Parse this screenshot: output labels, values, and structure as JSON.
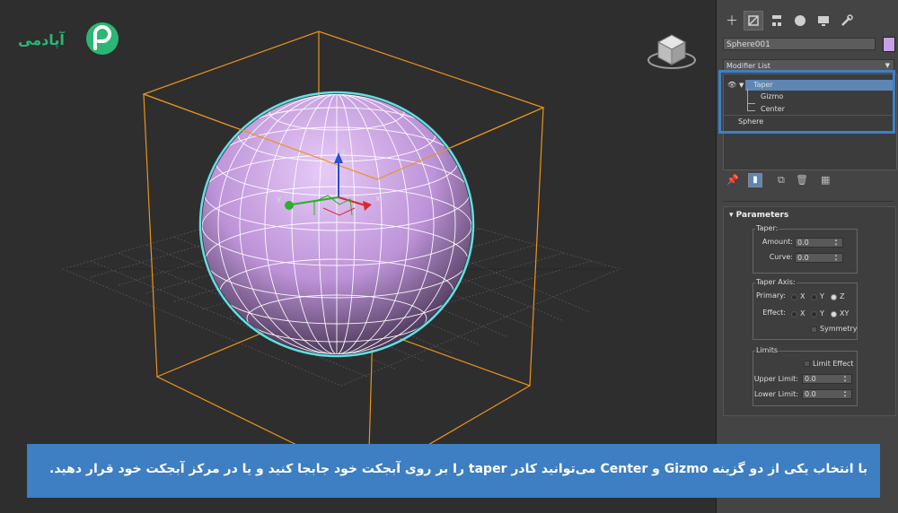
{
  "logo": {
    "text": "آپادمی",
    "icon": "aparat-p-logo"
  },
  "viewport": {
    "accent_bbox": "#e8941c",
    "accent_selection": "#5fe0e6",
    "sphere_color": "#c8a0e6",
    "axes": {
      "x": "x",
      "y": "y",
      "z": "z"
    }
  },
  "command_panel": {
    "tabs": [
      {
        "name": "create",
        "icon": "plus-icon"
      },
      {
        "name": "modify",
        "icon": "modify-icon",
        "active": true
      },
      {
        "name": "hierarchy",
        "icon": "hierarchy-icon"
      },
      {
        "name": "motion",
        "icon": "motion-icon"
      },
      {
        "name": "display",
        "icon": "display-icon"
      },
      {
        "name": "utilities",
        "icon": "wrench-icon"
      }
    ],
    "object_name": "Sphere001",
    "object_color": "#c8a0e6",
    "modifier_list": "Modifier List",
    "stack": {
      "modifier": "Taper",
      "sub_gizmo": "Gizmo",
      "sub_center": "Center",
      "base": "Sphere"
    },
    "parameters": {
      "title": "Parameters",
      "taper_group": "Taper:",
      "amount_label": "Amount:",
      "amount_value": "0.0",
      "curve_label": "Curve:",
      "curve_value": "0.0",
      "axis_group": "Taper Axis:",
      "primary_label": "Primary:",
      "primary_options": [
        "X",
        "Y",
        "Z"
      ],
      "primary_selected": "Z",
      "effect_label": "Effect:",
      "effect_options": [
        "X",
        "Y",
        "XY"
      ],
      "effect_selected": "XY",
      "symmetry_label": "Symmetry",
      "limits_group": "Limits",
      "limit_effect_label": "Limit Effect",
      "upper_limit_label": "Upper Limit:",
      "upper_limit_value": "0.0",
      "lower_limit_label": "Lower Limit:",
      "lower_limit_value": "0.0"
    }
  },
  "caption": "با انتخاب یکی از دو گزینه Gizmo و Center می‌توانید کادر taper را بر روی آبجکت خود جابجا کنید و یا در مرکز آبجکت خود قرار دهید."
}
